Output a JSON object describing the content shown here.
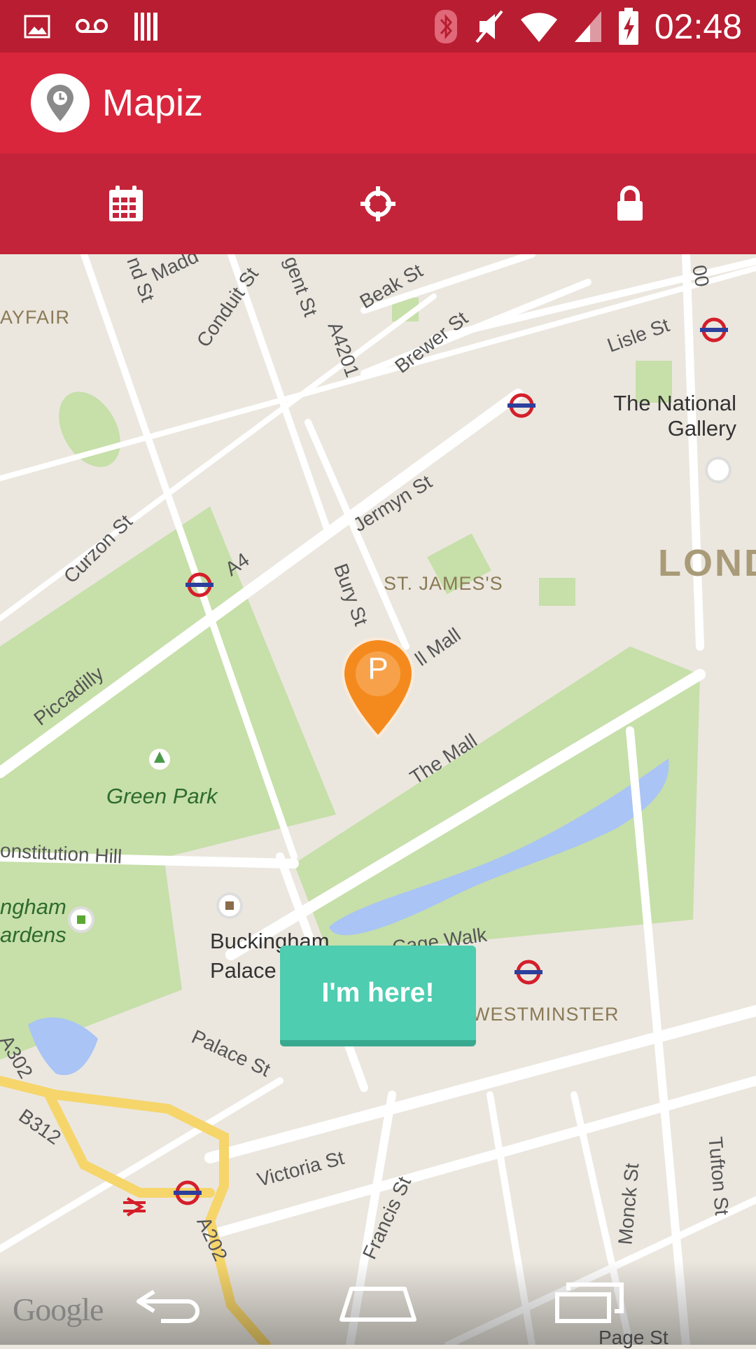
{
  "status_bar": {
    "time": "02:48",
    "left_icons": [
      "image-icon",
      "voicemail-icon",
      "barcode-icon"
    ],
    "right_icons": [
      "bluetooth-icon",
      "mute-icon",
      "wifi-icon",
      "signal-icon",
      "battery-charging-icon"
    ]
  },
  "app": {
    "title": "Mapiz",
    "logo_icon": "map-pin-icon",
    "primary_color": "#d9263d",
    "tab_bar_color": "#c4243a"
  },
  "tabs": [
    {
      "icon": "calendar-icon"
    },
    {
      "icon": "crosshair-icon"
    },
    {
      "icon": "lock-icon"
    }
  ],
  "map": {
    "labels": {
      "mayfair": "AYFAIR",
      "conduit_st": "Conduit St",
      "regent_st": "gent St",
      "maddox_st": "Madd",
      "bond_st": "nd St",
      "beak_st": "Beak St",
      "brewer_st": "Brewer St",
      "a4201": "A4201",
      "lisle_st": "Lisle St",
      "a400": "00",
      "national_gallery": "The National\nGallery",
      "jermyn_st": "Jermyn St",
      "curzon_st": "Curzon St",
      "a4": "A4",
      "bury_st": "Bury St",
      "st_jamess": "ST. JAMES'S",
      "london": "LOND",
      "pall_mall": "ll Mall",
      "piccadilly": "Piccadilly",
      "green_park": "Green Park",
      "the_mall": "The Mall",
      "constitution_hill": "onstitution Hill",
      "gardens": "ngham\nardens",
      "buckingham_palace": "Buckingham\nPalace",
      "birdcage_walk": "Cage Walk",
      "westminster": "WESTMINSTER",
      "a302": "A302",
      "palace_st": "Palace St",
      "b312": "B312",
      "victoria_st": "Victoria St",
      "francis_st": "Francis St",
      "monck_st": "Monck St",
      "tufton_st": "Tufton St",
      "a202": "A202",
      "page_st": "Page St"
    },
    "marker": {
      "letter": "P",
      "color": "#f48a1e"
    },
    "attribution": "Google"
  },
  "actions": {
    "here_button_label": "I'm here!",
    "here_button_color": "#4ecdb0"
  },
  "nav_bar": {
    "icons": [
      "back-icon",
      "home-icon",
      "recents-icon"
    ]
  }
}
